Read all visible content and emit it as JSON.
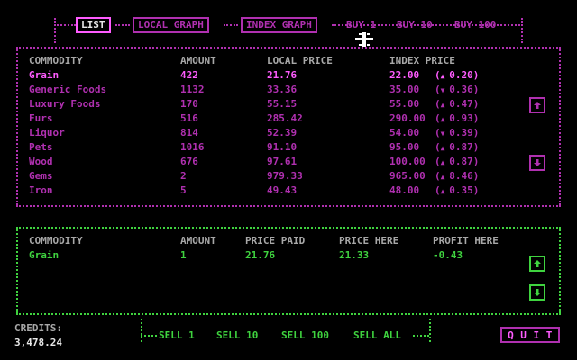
{
  "toolbar": {
    "tabs": [
      {
        "label": "LIST",
        "active": true
      },
      {
        "label": "LOCAL GRAPH",
        "active": false
      },
      {
        "label": "INDEX GRAPH",
        "active": false
      }
    ],
    "buy_buttons": [
      "BUY 1",
      "BUY 10",
      "BUY 100"
    ]
  },
  "market": {
    "headers": [
      "COMMODITY",
      "AMOUNT",
      "LOCAL PRICE",
      "INDEX PRICE"
    ],
    "rows": [
      {
        "commodity": "Grain",
        "amount": "422",
        "local_price": "21.76",
        "index_price": "22.00",
        "trend": "up",
        "change": "0.20",
        "selected": true
      },
      {
        "commodity": "Generic Foods",
        "amount": "1132",
        "local_price": "33.36",
        "index_price": "35.00",
        "trend": "down",
        "change": "0.36"
      },
      {
        "commodity": "Luxury Foods",
        "amount": "170",
        "local_price": "55.15",
        "index_price": "55.00",
        "trend": "up",
        "change": "0.47"
      },
      {
        "commodity": "Furs",
        "amount": "516",
        "local_price": "285.42",
        "index_price": "290.00",
        "trend": "up",
        "change": "0.93"
      },
      {
        "commodity": "Liquor",
        "amount": "814",
        "local_price": "52.39",
        "index_price": "54.00",
        "trend": "down",
        "change": "0.39"
      },
      {
        "commodity": "Pets",
        "amount": "1016",
        "local_price": "91.10",
        "index_price": "95.00",
        "trend": "up",
        "change": "0.87"
      },
      {
        "commodity": "Wood",
        "amount": "676",
        "local_price": "97.61",
        "index_price": "100.00",
        "trend": "up",
        "change": "0.87"
      },
      {
        "commodity": "Gems",
        "amount": "2",
        "local_price": "979.33",
        "index_price": "965.00",
        "trend": "up",
        "change": "8.46"
      },
      {
        "commodity": "Iron",
        "amount": "5",
        "local_price": "49.43",
        "index_price": "48.00",
        "trend": "up",
        "change": "0.35"
      }
    ]
  },
  "cargo": {
    "headers": [
      "COMMODITY",
      "AMOUNT",
      "PRICE PAID",
      "PRICE HERE",
      "PROFIT HERE"
    ],
    "rows": [
      {
        "commodity": "Grain",
        "amount": "1",
        "price_paid": "21.76",
        "price_here": "21.33",
        "profit": "-0.43"
      }
    ]
  },
  "credits": {
    "label": "CREDITS:",
    "value": "3,478.24"
  },
  "sell_buttons": [
    "SELL 1",
    "SELL 10",
    "SELL 100",
    "SELL ALL"
  ],
  "quit_label": "Q U I T",
  "colors": {
    "magenta": "#b030b0",
    "bright_magenta": "#ff5cff",
    "green": "#3fd33f",
    "gray": "#a8a8a8"
  }
}
